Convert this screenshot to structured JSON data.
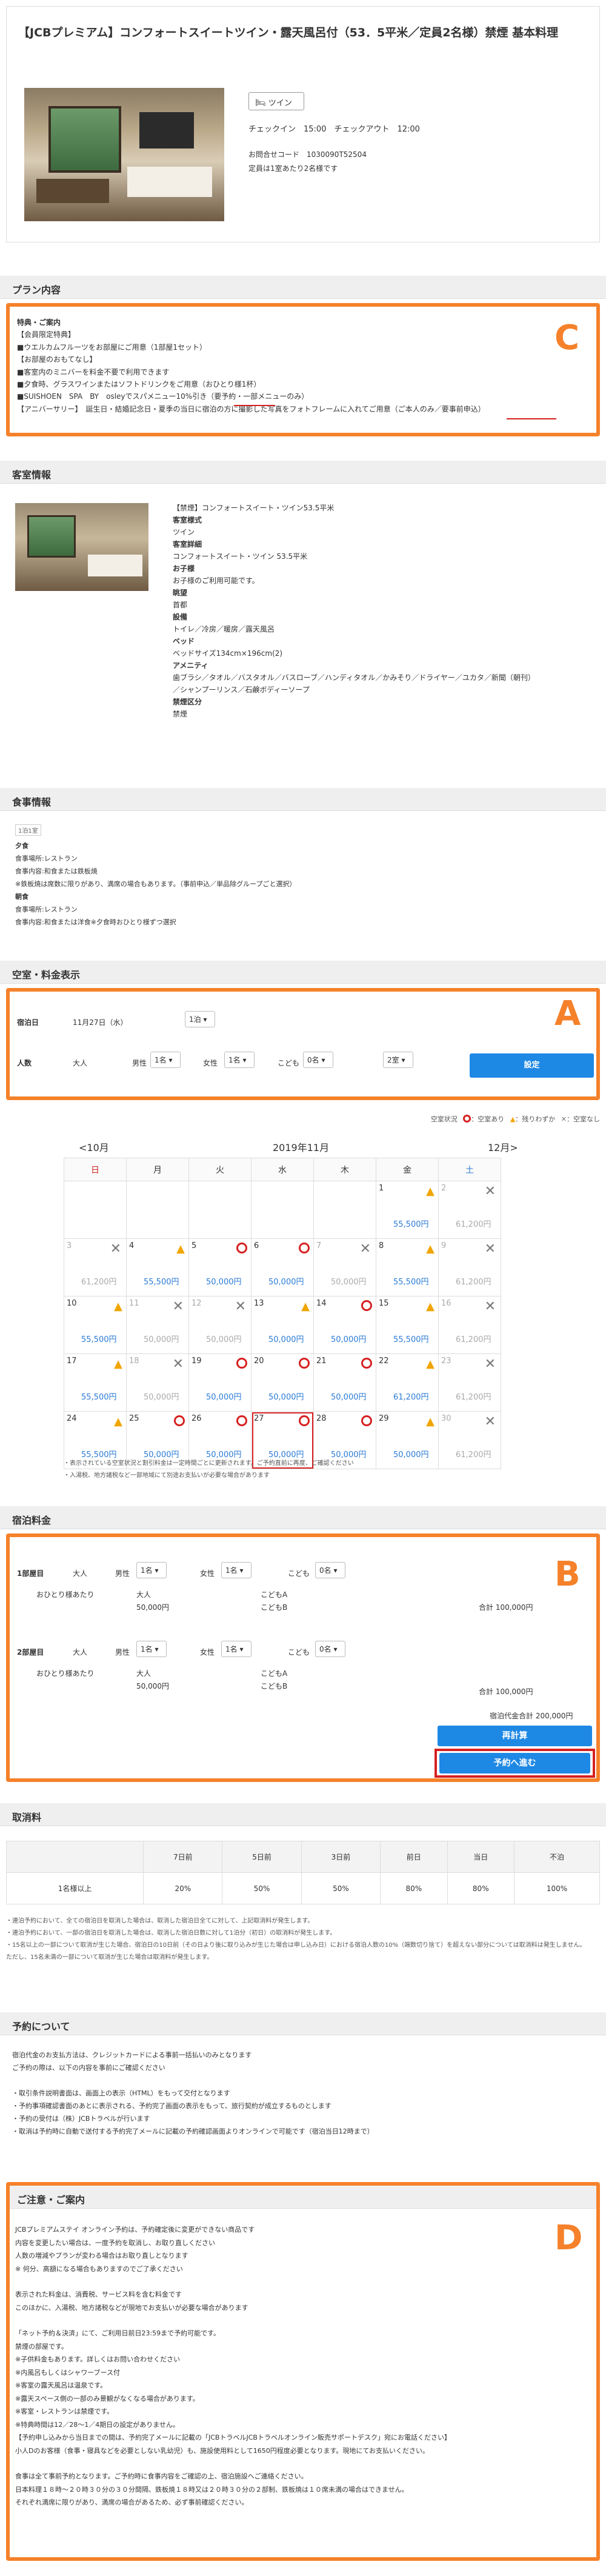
{
  "header": {
    "title": "【JCBプレミアム】コンフォートスイートツイン・露天風呂付（53．5平米／定員2名様）禁煙 基本料理",
    "room_type_tag": "ツイン",
    "checkin": "チェックイン　15:00　チェックアウト　12:00",
    "inquiry_code": "お問合せコード　1030090T52504",
    "capacity": "定員は1室あたり2名様です"
  },
  "plan": {
    "heading": "プラン内容",
    "lines": [
      "特典・ご案内",
      "【会員限定特典】",
      "■ウエルカムフルーツをお部屋にご用意（1部屋1セット）",
      "【お部屋のおもてなし】",
      "■客室内のミニバーを料金不要で利用できます",
      "■夕食時、グラスワインまたはソフトドリンクをご用意（おひとり様1杯）",
      "■SUISHOEN　SPA　BY　osleyでスパメニュー10%引き（要予約・一部メニューのみ）",
      "【アニバーサリー】　誕生日・結婚記念日・夏季の当日に宿泊の方に撮影した写真をフォトフレームに入れてご用意（ご本人のみ／要事前申込）"
    ],
    "label": "C"
  },
  "guest": {
    "heading": "客室情報",
    "lines": [
      "【禁煙】コンフォートスイート・ツイン53.5平米",
      "客室様式",
      "ツイン",
      "客室詳細",
      "コンフォートスイート・ツイン 53.5平米",
      "お子様",
      "お子様のご利用可能です。",
      "眺望",
      "首都",
      "設備",
      "トイレ／冷房／暖房／露天風呂",
      "ベッド",
      "ベッドサイズ134cm×196cm(2)",
      "アメニティ",
      "歯ブラシ／タオル／バスタオル／バスローブ／ハンディタオル／かみそり／ドライヤー／ユカタ／新聞（朝刊）",
      "／シャンプーリンス／石鹸ボディーソープ",
      "禁煙区分",
      "禁煙"
    ]
  },
  "meal": {
    "heading": "食事情報",
    "tag": "1泊1室",
    "lines": [
      "夕食",
      "食事場所:レストラン",
      "食事内容:和食または鉄板焼",
      "※鉄板焼は席数に限りがあり、満席の場合もあります。（事前申込／単品除グループごと選択）",
      "朝食",
      "食事場所:レストラン",
      "食事内容:和食または洋食※夕食時おひとり様ずつ選択"
    ]
  },
  "vacancy": {
    "heading": "空室・料金表示",
    "label": "A",
    "date_label": "宿泊日",
    "date_value": "11月27日（水）",
    "nights": "1泊",
    "people_label": "人数",
    "adult": "大人",
    "male": "男性",
    "male_val": "1名",
    "female": "女性",
    "female_val": "1名",
    "child": "こども",
    "child_val": "0名",
    "rooms": "2室",
    "set_button": "設定"
  },
  "calendar": {
    "legend_label": "空室状況",
    "legend_full": "：空室あり",
    "legend_few": "：残りわずか",
    "legend_none": "：空室なし",
    "prev": "<10月",
    "next": "12月>",
    "month": "2019年11月",
    "weekdays": [
      "日",
      "月",
      "火",
      "水",
      "木",
      "金",
      "土"
    ],
    "weeks": [
      [
        null,
        null,
        null,
        null,
        null,
        {
          "d": "1",
          "p": "55,500円",
          "s": "tri"
        },
        {
          "d": "2",
          "p": "61,200円",
          "s": "x"
        }
      ],
      [
        {
          "d": "3",
          "p": "61,200円",
          "s": "x"
        },
        {
          "d": "4",
          "p": "55,500円",
          "s": "tri"
        },
        {
          "d": "5",
          "p": "50,000円",
          "s": "o"
        },
        {
          "d": "6",
          "p": "50,000円",
          "s": "o"
        },
        {
          "d": "7",
          "p": "50,000円",
          "s": "x"
        },
        {
          "d": "8",
          "p": "55,500円",
          "s": "tri"
        },
        {
          "d": "9",
          "p": "61,200円",
          "s": "x"
        }
      ],
      [
        {
          "d": "10",
          "p": "55,500円",
          "s": "tri"
        },
        {
          "d": "11",
          "p": "50,000円",
          "s": "x"
        },
        {
          "d": "12",
          "p": "50,000円",
          "s": "x"
        },
        {
          "d": "13",
          "p": "50,000円",
          "s": "tri"
        },
        {
          "d": "14",
          "p": "50,000円",
          "s": "o"
        },
        {
          "d": "15",
          "p": "55,500円",
          "s": "tri"
        },
        {
          "d": "16",
          "p": "61,200円",
          "s": "x"
        }
      ],
      [
        {
          "d": "17",
          "p": "55,500円",
          "s": "tri"
        },
        {
          "d": "18",
          "p": "50,000円",
          "s": "x"
        },
        {
          "d": "19",
          "p": "50,000円",
          "s": "o"
        },
        {
          "d": "20",
          "p": "50,000円",
          "s": "o"
        },
        {
          "d": "21",
          "p": "50,000円",
          "s": "o"
        },
        {
          "d": "22",
          "p": "61,200円",
          "s": "tri"
        },
        {
          "d": "23",
          "p": "61,200円",
          "s": "x"
        }
      ],
      [
        {
          "d": "24",
          "p": "55,500円",
          "s": "tri"
        },
        {
          "d": "25",
          "p": "50,000円",
          "s": "o"
        },
        {
          "d": "26",
          "p": "50,000円",
          "s": "o"
        },
        {
          "d": "27",
          "p": "50,000円",
          "s": "o",
          "sel": true
        },
        {
          "d": "28",
          "p": "50,000円",
          "s": "o"
        },
        {
          "d": "29",
          "p": "50,000円",
          "s": "tri"
        },
        {
          "d": "30",
          "p": "61,200円",
          "s": "x"
        }
      ]
    ],
    "notes": [
      "・表示されている空室状況と割引料金は一定時間ごとに更新されます。ご予約直前に再度、ご確認ください",
      "・入湯税、地方諸税など一部地域にて別途お支払いが必要な場合があります"
    ]
  },
  "fee": {
    "heading": "宿泊料金",
    "label": "B",
    "room1": "1部屋目",
    "room2": "2部屋目",
    "adult": "大人",
    "per_person": "おひとり様あたり",
    "male": "男性",
    "female": "女性",
    "child": "こども",
    "male_val": "1名",
    "female_val": "1名",
    "child_val": "0名",
    "adult_col": "大人",
    "adult_price": "50,000円",
    "child_col": "こどもA",
    "child_price": "こどもB",
    "subtotal": "合計 100,000円",
    "total": "宿泊代金合計 200,000円",
    "recalc": "再計算",
    "reserve": "予約へ進む"
  },
  "cancel": {
    "heading": "取消料",
    "cols": [
      "",
      "7日前",
      "5日前",
      "3日前",
      "前日",
      "当日",
      "不泊"
    ],
    "row": [
      "1名様以上",
      "20%",
      "50%",
      "50%",
      "80%",
      "80%",
      "100%"
    ],
    "notes": [
      "・連泊予約において、全ての宿泊日を取消した場合は、取消した宿泊日全てに対して、上記取消料が発生します。",
      "・連泊予約において、一部の宿泊日を取消した場合は、取消した宿泊日数に対して1泊分（初日）の取消料が発生します。",
      "・15名以上の一部について取消が生じた場合、宿泊日の10日前（その日より後に取り込みが生じた場合は申し込み日）における宿泊人数の10%（端数切り捨て）を超えない部分については取消料は発生しません。",
      "ただし、15名未満の一部について取消が生じた場合は取消料が発生します。"
    ]
  },
  "about": {
    "heading": "予約について",
    "lines": [
      "宿泊代金のお支払方法は、クレジットカードによる事前一括払いのみとなります",
      "ご予約の際は、以下の内容を事前にご確認ください",
      "",
      "・取引条件説明書面は、画面上の表示（HTML）をもって交付となります",
      "・予約事項確認書面のあとに表示される、予約完了画面の表示をもって、旅行契約が成立するものとします",
      "・予約の受付は（株）JCBトラベルが行います",
      "・取消は予約時に自動で送付する予約完了メールに記載の予約確認画面よりオンラインで可能です（宿泊当日12時まで）"
    ]
  },
  "notice": {
    "heading": "ご注意・ご案内",
    "label": "D",
    "lines": [
      "JCBプレミアムステイ オンライン予約は、予約確定後に変更ができない商品です",
      "内容を変更したい場合は、一度予約を取消し、お取り直しください",
      "人数の増減やプランが変わる場合はお取り直しとなります",
      "※ 何分、高額になる場合もありますのでご了承ください",
      "",
      "表示された料金は、消費税、サービス料を含む料金です",
      "このほかに、入湯税、地方諸税などが現地でお支払いが必要な場合があります",
      "",
      "「ネット予約＆決済」にて、ご利用日前日23:59まで予約可能です。",
      "禁煙の部屋です。",
      "※子供料金もあります。詳しくはお問い合わせください",
      "※内風呂もしくはシャワーブース付",
      "※客室の露天風呂は温泉です。",
      "※露天スペース側の一部のみ景観がなくなる場合があります。",
      "※客室・レストランは禁煙です。",
      "※特典時間は12／28～1／4期日の設定がありません。",
      "【予約申し込みから当日までの間は、予約完了メールに記載の「JCBトラベルJCBトラベルオンライン販売サポートデスク」宛にお電話ください】",
      "小人Dのお客様（食事・寝具などを必要としない乳幼児）も、施設使用料として1650円程度必要となります。現地にてお支払いください。",
      "",
      "食事は全て事前予約となります。ご予約時に食事内容をご確認の上、宿泊施設へご連絡ください。",
      "日本料理１８時～２０時３０分の３０分間隔、鉄板焼１８時又は２０時３０分の２部制、鉄板焼は１０席未満の場合はできません。",
      "それぞれ満席に限りがあり、満席の場合があるため、必ず事前確認ください。"
    ]
  }
}
